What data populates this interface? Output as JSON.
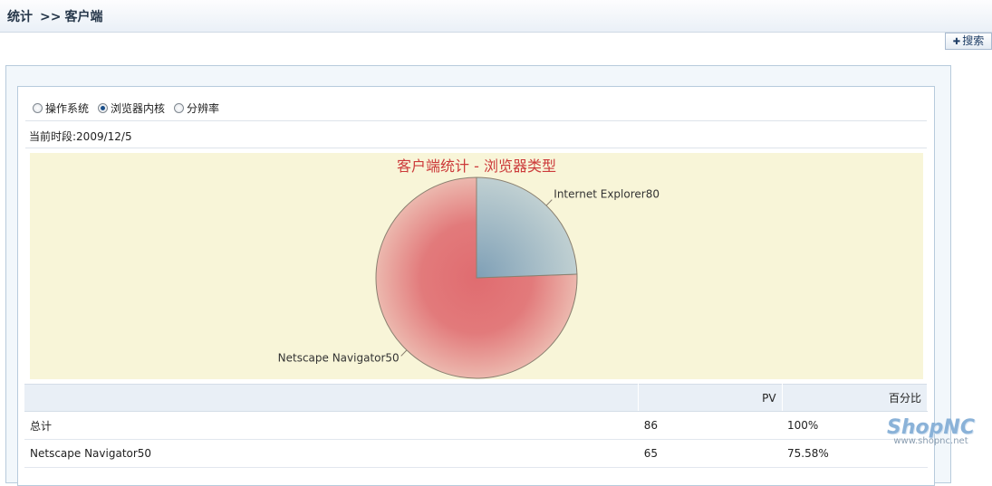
{
  "breadcrumb": {
    "section": "统计",
    "separator": ">>",
    "page": "客户端"
  },
  "toolbar": {
    "search_label": "搜索"
  },
  "filters": {
    "options": [
      "操作系统",
      "浏览器内核",
      "分辨率"
    ],
    "selected": "浏览器内核"
  },
  "period": {
    "label": "当前时段:2009/12/5"
  },
  "chart_data": {
    "type": "pie",
    "title": "客户端统计 - 浏览器类型",
    "labels": [
      "Netscape Navigator",
      "Internet Explorer"
    ],
    "values": [
      65,
      21
    ],
    "slice_labels": [
      "Netscape Navigator50",
      "Internet Explorer80"
    ],
    "colors": [
      "#e07678",
      "#8aa8bf"
    ],
    "background": "#f8f5d8",
    "title_color": "#cc3a3a"
  },
  "table": {
    "headers": [
      "",
      "PV",
      "百分比"
    ],
    "rows": [
      [
        "总计",
        "86",
        "100%"
      ],
      [
        "Netscape Navigator50",
        "65",
        "75.58%"
      ]
    ]
  },
  "logo": {
    "brand": "ShopNC",
    "url": "www.shopnc.net"
  }
}
